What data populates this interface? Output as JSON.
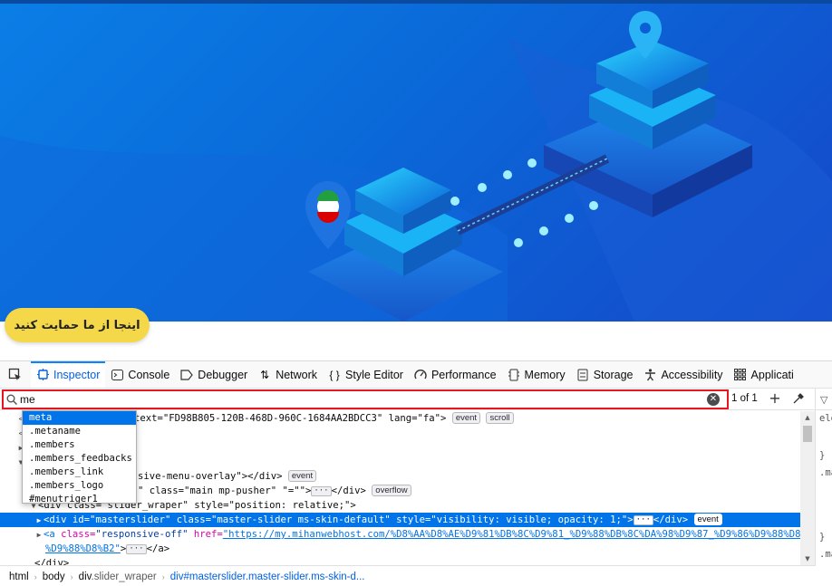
{
  "page": {
    "support_button": "اینجا از ما حمایت کنید",
    "hero_flag": "iran-flag-pin"
  },
  "devtools": {
    "tabs": [
      {
        "label": "Inspector",
        "icon": "inspector-icon",
        "active": true
      },
      {
        "label": "Console",
        "icon": "console-icon"
      },
      {
        "label": "Debugger",
        "icon": "debugger-icon"
      },
      {
        "label": "Network",
        "icon": "network-icon"
      },
      {
        "label": "Style Editor",
        "icon": "style-editor-icon"
      },
      {
        "label": "Performance",
        "icon": "performance-icon"
      },
      {
        "label": "Memory",
        "icon": "memory-icon"
      },
      {
        "label": "Storage",
        "icon": "storage-icon"
      },
      {
        "label": "Accessibility",
        "icon": "accessibility-icon"
      },
      {
        "label": "Applicati",
        "icon": "application-icon"
      }
    ],
    "search": {
      "value": "me",
      "match_count": "1 of 1"
    },
    "autocomplete": [
      ".meta",
      ".metaname",
      ".members",
      ".members_feedbacks",
      ".members_link",
      ".members_logo",
      "#menutriger1"
    ],
    "autocomplete_display": [
      "meta",
      ".metaname",
      ".members",
      ".members_feedbacks",
      ".members_link",
      ".members_logo",
      "#menutriger1"
    ],
    "tree": {
      "r1_text": "text=\"FD98B805-120B-468D-960C-1684AA2BDCC3\" lang=\"fa\">",
      "r1_badges": [
        "event",
        "scroll"
      ],
      "r4_text": "sive-menu-overlay\"></div>",
      "r4_badge": "event",
      "r5_text": "\" class=\"main mp-pusher\" \"=\"\">",
      "r5_end": "</div>",
      "r5_badge": "overflow",
      "r6_text": "slider_wraper\" style=\"position: relative;\">",
      "r6_prefix": "<div class=\"",
      "r7_open": "<div ",
      "r7_id_attr": "id=",
      "r7_id_val": "\"masterslider\"",
      "r7_class_attr": " class=",
      "r7_class_val": "\"master-slider ms-skin-default\"",
      "r7_style_attr": " style=",
      "r7_style_val": "\"visibility: visible; opacity: 1;\"",
      "r7_end": "</div>",
      "r7_badge": "event",
      "r8_open": "<a ",
      "r8_class_attr": "class=",
      "r8_class_val": "\"responsive-off\"",
      "r8_href_attr": " href=",
      "r8_href_val": "\"https://my.mihanwebhost.com/%D8%AA%D8%AE%D9%81%DB%8C%D9%81_%D9%88%DB%8C%DA%98%D9%87_%D9%86%D9%88%D8%B1",
      "r8b_val": "%D9%88%D8%B2\"",
      "r8b_end": "</a>",
      "r9_text": "</div>"
    },
    "rules": {
      "r1": "ele",
      "r2": "}",
      "r3": ".ma",
      "r4": "}",
      "r5": ".ma"
    },
    "breadcrumbs": [
      {
        "tag": "html",
        "cls": ""
      },
      {
        "tag": "body",
        "cls": ""
      },
      {
        "tag": "div",
        "cls": ".slider_wraper"
      },
      {
        "tag": "div",
        "cls": "#masterslider.master-slider.ms-skin-d..."
      }
    ]
  },
  "colors": {
    "accent": "#0074e8",
    "search_highlight": "#e5181f",
    "support_button": "#f5d84a"
  }
}
